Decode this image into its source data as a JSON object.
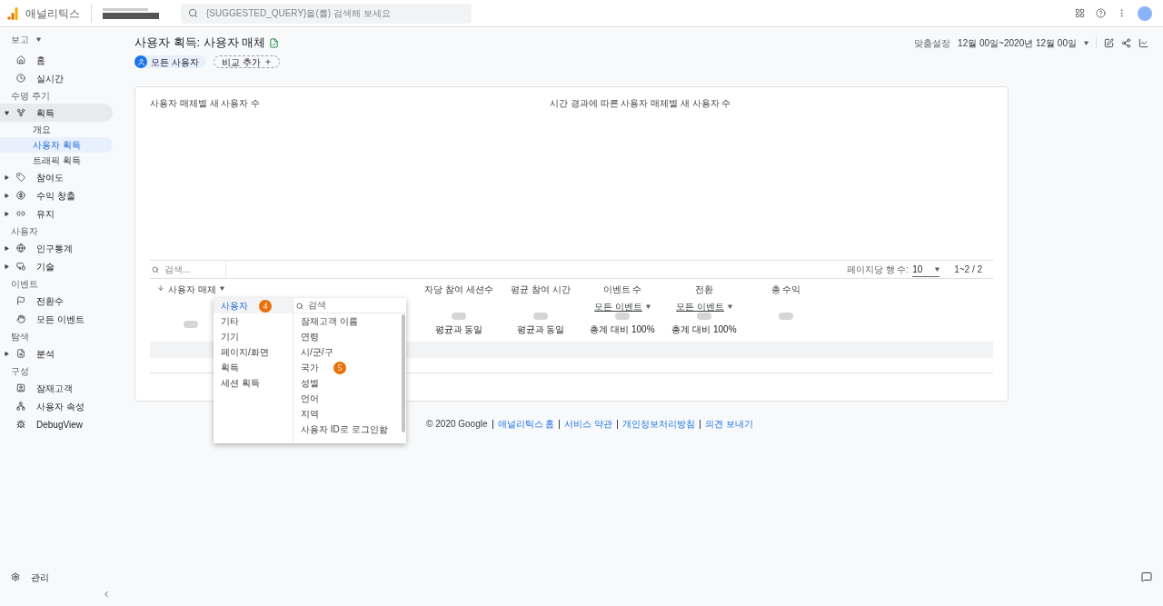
{
  "header": {
    "product": "애널리틱스",
    "search_placeholder": "{SUGGESTED_QUERY}을(를) 검색해 보세요"
  },
  "sidebar": {
    "report_label": "보고",
    "items": [
      {
        "kind": "item",
        "label": "홈",
        "selected": false
      },
      {
        "kind": "item",
        "label": "실시간",
        "selected": false
      },
      {
        "kind": "section",
        "label": "수명 주기"
      },
      {
        "kind": "item",
        "label": "획득",
        "selected": true,
        "expanded": true
      },
      {
        "kind": "sub",
        "label": "개요",
        "selected": false
      },
      {
        "kind": "sub",
        "label": "사용자 획득",
        "selected": true
      },
      {
        "kind": "sub",
        "label": "트래픽 획득",
        "selected": false
      },
      {
        "kind": "item",
        "label": "참여도",
        "selected": false,
        "expanded": false
      },
      {
        "kind": "item",
        "label": "수익 창출",
        "selected": false,
        "expanded": false
      },
      {
        "kind": "item",
        "label": "유지",
        "selected": false,
        "expanded": false
      },
      {
        "kind": "section",
        "label": "사용자"
      },
      {
        "kind": "item",
        "label": "인구통계",
        "selected": false,
        "expanded": false
      },
      {
        "kind": "item",
        "label": "기술",
        "selected": false,
        "expanded": false
      },
      {
        "kind": "section",
        "label": "이벤트"
      },
      {
        "kind": "item",
        "label": "전환수",
        "selected": false
      },
      {
        "kind": "item",
        "label": "모든 이벤트",
        "selected": false
      },
      {
        "kind": "section",
        "label": "탐색"
      },
      {
        "kind": "item",
        "label": "분석",
        "selected": false,
        "expanded": false
      },
      {
        "kind": "section",
        "label": "구성"
      },
      {
        "kind": "item",
        "label": "잠재고객",
        "selected": false
      },
      {
        "kind": "item",
        "label": "사용자 속성",
        "selected": false
      },
      {
        "kind": "item",
        "label": "DebugView",
        "selected": false
      }
    ],
    "admin": "관리"
  },
  "page": {
    "title": "사용자 획득: 사용자 매체",
    "segment": "모든 사용자",
    "compare": "비교 추가",
    "date_label": "맞춤설정",
    "date_range": "12월 00일~2020년 12월 00일"
  },
  "card": {
    "chart_title_left": "사용자 매체별 새 사용자 수",
    "chart_title_right": "시간 경과에 따른 사용자 매체별 새 사용자 수",
    "table": {
      "search_placeholder": "검색...",
      "rows_per_page_label": "페이지당 행 수:",
      "rows_per_page": "10",
      "pagination": "1~2 / 2",
      "dimension": "사용자 매체",
      "columns": [
        {
          "label": "자당 참여 세션수"
        },
        {
          "label": "평균 참여 시간"
        },
        {
          "label": "이벤트 수",
          "sub": "모든 이벤트"
        },
        {
          "label": "전환",
          "sub": "모든 이벤트"
        },
        {
          "label": "총 수익"
        }
      ],
      "row": [
        "평균과 동일",
        "평균과 동일",
        "총계 대비 100%",
        "총계 대비 100%"
      ]
    }
  },
  "dropdown": {
    "categories": [
      {
        "label": "사용자",
        "selected": true
      },
      {
        "label": "기타",
        "selected": false
      },
      {
        "label": "기기",
        "selected": false
      },
      {
        "label": "페이지/화면",
        "selected": false
      },
      {
        "label": "획득",
        "selected": false
      },
      {
        "label": "세션 획득",
        "selected": false
      }
    ],
    "search_placeholder": "검색",
    "options": [
      "잠재고객 이름",
      "연령",
      "시/군/구",
      "국가",
      "성별",
      "언어",
      "지역",
      "사용자 ID로 로그인함"
    ],
    "markers": [
      "4",
      "5"
    ]
  },
  "footer": {
    "copyright": "© 2020 Google",
    "links": [
      "애널리틱스 홈",
      "서비스 약관",
      "개인정보처리방침",
      "의견 보내기"
    ]
  }
}
